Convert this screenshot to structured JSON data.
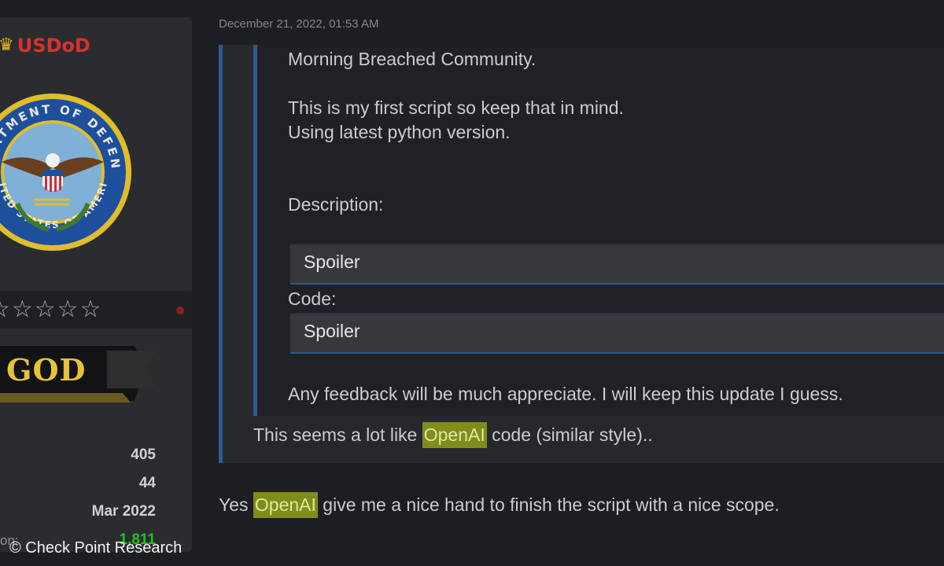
{
  "user": {
    "username": "USDoD",
    "crown_icon": "crown-icon",
    "avatar": {
      "icon": "department-of-defense-seal-icon",
      "seal_text_top": "DEPARTMENT OF DEFENSE",
      "seal_text_bottom": "UNITED STATES OF AMERICA"
    },
    "stars": "☆☆☆☆☆",
    "rank": "GOD",
    "stats": [
      {
        "label": "",
        "value": "405"
      },
      {
        "label": "",
        "value": "44"
      },
      {
        "label": "",
        "value": "Mar 2022"
      },
      {
        "label": "on:",
        "value": "1,811"
      }
    ]
  },
  "post": {
    "date": "December 21, 2022, 01:53 AM",
    "lines": [
      "Morning Breached Community.",
      "This is my first script so keep that in mind.",
      "Using latest python version.",
      "Description:",
      "Code:",
      "Any feedback will be much appreciate. I will keep this update I guess."
    ],
    "spoilers": [
      "Spoiler",
      "Spoiler"
    ],
    "reply": {
      "before": "This seems a lot like ",
      "highlight": "OpenAI",
      "after": " code (similar style).."
    },
    "answer": {
      "before": "Yes ",
      "highlight": "OpenAI",
      "after": " give me a nice hand to finish the script with a nice scope."
    }
  },
  "credit": "© Check Point Research",
  "colors": {
    "background": "#1d1e21",
    "username": "#d9312b",
    "quote_border": "#2e5b8f",
    "highlight": "#7f8d1c",
    "rank_gold": "#e5c23a",
    "reputation_green": "#1ec21e"
  }
}
